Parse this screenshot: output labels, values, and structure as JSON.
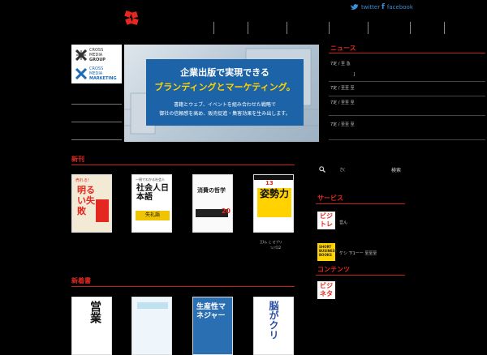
{
  "header": {
    "twitter_label": "twitter",
    "facebook_label": "facebook"
  },
  "sidebar_logo": {
    "group_lines": [
      "CROSS",
      "MEDIA",
      "GROUP"
    ],
    "marketing_lines": [
      "CROSS",
      "MEDIA",
      "MARKETING"
    ]
  },
  "banner": {
    "title_line1": "企業出版で実現できる",
    "title_line2": "ブランディングとマーケティング。",
    "body_line1": "書籍とウェブ、イベントを組み合わせた戦略で",
    "body_line2": "御社の信頼感を高め、販売促進・集客効果を生み出します。"
  },
  "sections": {
    "new_books": "新刊",
    "new_arrivals": "新着書",
    "news": "ニュース",
    "services": "サービス",
    "contents": "コンテンツ"
  },
  "news_items": [
    {
      "date": "7定 / 至 急",
      "text": "",
      "extra": "J"
    },
    {
      "date": "7定 / 至至 至",
      "text": ""
    },
    {
      "date": "7定 / 至至 至",
      "text": ""
    },
    {
      "date": "7定 / 至至 至",
      "text": ""
    }
  ],
  "search": {
    "input_text": "さ(",
    "button_label": "検索"
  },
  "new_books": [
    {
      "top": "売れる!",
      "title": "明るい失敗",
      "sub": ""
    },
    {
      "top": "一冊でわかる社会人",
      "title": "社会人日本語",
      "sub": "失礼語"
    },
    {
      "top": "",
      "title": "消費の哲学",
      "sub": "20"
    },
    {
      "top": "13",
      "title": "姿勢力",
      "sub": ""
    }
  ],
  "new_books_caption": "王Iん こ せブリ",
  "new_books_caption2": "ツパ12",
  "new_arrivals": [
    {
      "title": "営業"
    },
    {
      "title": ""
    },
    {
      "title": "生産性マネジャー"
    },
    {
      "title": "脳がクリ"
    }
  ],
  "services": [
    {
      "badge": "ビジトレ",
      "label": "営ん"
    },
    {
      "badge": "SHORT BUSINESS BOOKS",
      "label": "ケシ 下1ーー 至至至"
    }
  ],
  "contents": [
    {
      "badge": "ビジネタ"
    }
  ],
  "colors": {
    "accent": "#e4281f",
    "banner_blue": "#1d63a8",
    "banner_yellow": "#ffd200"
  }
}
